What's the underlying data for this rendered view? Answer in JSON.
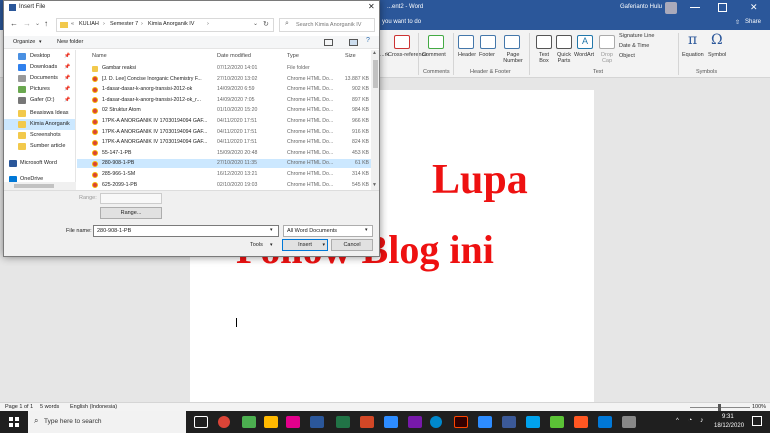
{
  "word": {
    "title": "...ent2 - Word",
    "user": "Gaferianto Hulu",
    "tell_me": "you want to do",
    "share": "Share",
    "ribbon_groups": [
      {
        "name": "Comments",
        "items": [
          "Comment"
        ]
      },
      {
        "name": "Header & Footer",
        "items": [
          "Header",
          "Footer",
          "Page Number"
        ]
      },
      {
        "name": "Text",
        "items": [
          "Text Box",
          "Quick Parts",
          "WordArt",
          "Drop Cap",
          "Signature Line",
          "Date & Time",
          "Object"
        ]
      },
      {
        "name": "Symbols",
        "items": [
          "Equation",
          "Symbol"
        ]
      }
    ],
    "ribbon_left": [
      "...rk",
      "Cross-reference"
    ],
    "document": {
      "line1": "Lupa",
      "line2": "Follow Blog ini"
    },
    "status": {
      "page": "Page 1 of 1",
      "words": "5 words",
      "language": "English (Indonesia)",
      "zoom": "100%"
    }
  },
  "dialog": {
    "title": "Insert File",
    "path": [
      "KULIAH",
      "Semester 7",
      "Kimia Anorganik IV"
    ],
    "search_placeholder": "Search Kimia Anorganik IV",
    "organize": "Organize",
    "new_folder": "New folder",
    "nav": [
      "Desktop",
      "Downloads",
      "Documents",
      "Pictures",
      "Gafer (D:)",
      "Beasiswa Ideas",
      "Kimia Anorganik",
      "Screenshots",
      "Sumber article",
      "Microsoft Word",
      "OneDrive"
    ],
    "columns": [
      "Name",
      "Date modified",
      "Type",
      "Size"
    ],
    "files": [
      {
        "name": "Gambar reaksi",
        "date": "07/12/2020 14:01",
        "type": "File folder",
        "size": "",
        "kind": "folder"
      },
      {
        "name": "[J. D. Lee] Concise Inorganic Chemistry F...",
        "date": "27/10/2020 13:02",
        "type": "Chrome HTML Do...",
        "size": "13.887 KB",
        "kind": "chrome"
      },
      {
        "name": "1-dasar-dasar-k-anorg-transisi-2012-ok",
        "date": "14/09/2020 6:59",
        "type": "Chrome HTML Do...",
        "size": "902 KB",
        "kind": "chrome"
      },
      {
        "name": "1-dasar-dasar-k-anorg-transisi-2012-ok_r...",
        "date": "14/09/2020 7:05",
        "type": "Chrome HTML Do...",
        "size": "897 KB",
        "kind": "chrome"
      },
      {
        "name": "02 Struktur Atom",
        "date": "01/10/2020 15:20",
        "type": "Chrome HTML Do...",
        "size": "984 KB",
        "kind": "chrome"
      },
      {
        "name": "17PK-A ANORGANIK IV 17030194094 GAF...",
        "date": "04/11/2020 17:51",
        "type": "Chrome HTML Do...",
        "size": "966 KB",
        "kind": "chrome"
      },
      {
        "name": "17PK-A ANORGANIK IV 17030194094 GAF...",
        "date": "04/11/2020 17:51",
        "type": "Chrome HTML Do...",
        "size": "916 KB",
        "kind": "chrome"
      },
      {
        "name": "17PK-A ANORGANIK IV 17030194094 GAF...",
        "date": "04/11/2020 17:51",
        "type": "Chrome HTML Do...",
        "size": "824 KB",
        "kind": "chrome"
      },
      {
        "name": "55-147-1-PB",
        "date": "15/09/2020 20:48",
        "type": "Chrome HTML Do...",
        "size": "453 KB",
        "kind": "chrome"
      },
      {
        "name": "280-908-1-PB",
        "date": "27/10/2020 11:35",
        "type": "Chrome HTML Do...",
        "size": "61 KB",
        "kind": "chrome",
        "selected": true
      },
      {
        "name": "285-966-1-SM",
        "date": "16/12/2020 13:21",
        "type": "Chrome HTML Do...",
        "size": "314 KB",
        "kind": "chrome"
      },
      {
        "name": "625-2099-1-PB",
        "date": "02/10/2020 19:03",
        "type": "Chrome HTML Do...",
        "size": "545 KB",
        "kind": "chrome"
      }
    ],
    "range_label": "Range:",
    "range_button": "Range...",
    "filename_label": "File name:",
    "filename_value": "280-908-1-PB",
    "filetype": "All Word Documents",
    "tools": "Tools",
    "insert": "Insert",
    "cancel": "Cancel"
  },
  "taskbar": {
    "search": "Type here to search",
    "time": "9:31",
    "date": "18/12/2020"
  },
  "colors": {
    "word_blue": "#2b579a",
    "doc_red": "#ee1111",
    "chrome_red": "#db4437",
    "folder": "#f2c94c",
    "selected_row": "#cce8ff"
  }
}
